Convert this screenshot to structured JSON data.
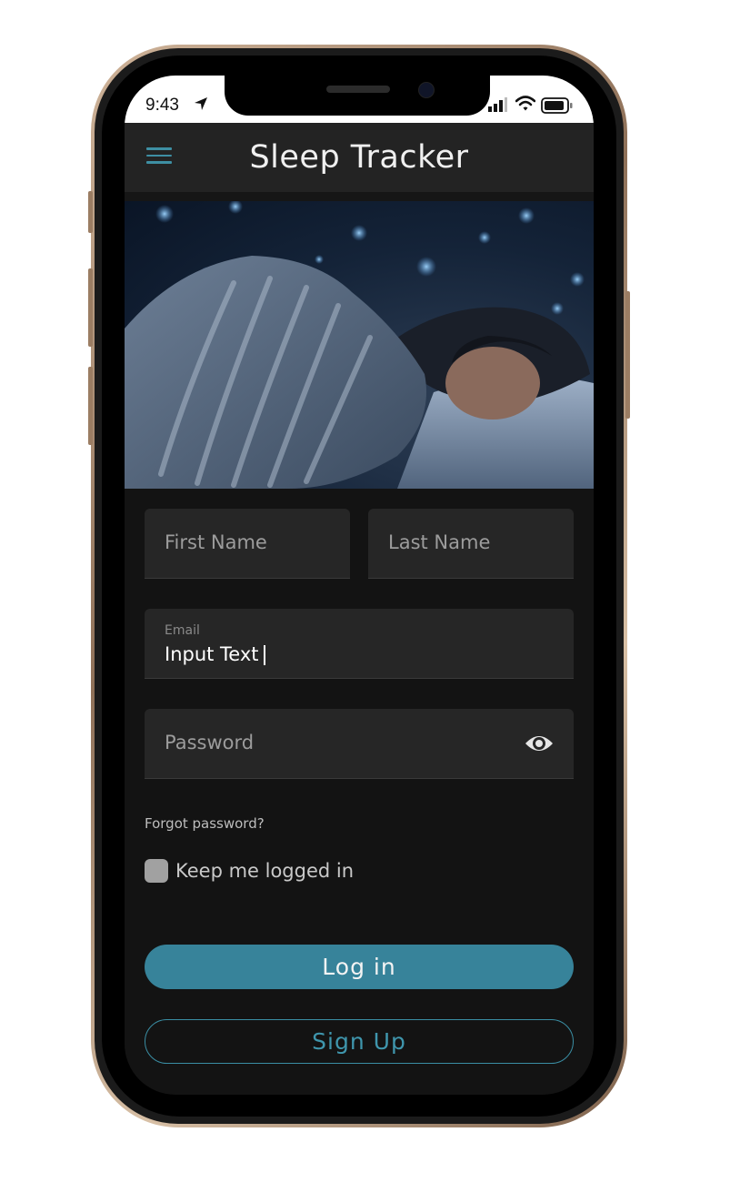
{
  "status_bar": {
    "time": "9:43"
  },
  "app_bar": {
    "title": "Sleep Tracker"
  },
  "form": {
    "first_name_placeholder": "First Name",
    "last_name_placeholder": "Last Name",
    "email_label": "Email",
    "email_value": "Input Text",
    "password_placeholder": "Password",
    "forgot_password": "Forgot password?",
    "keep_logged_in": "Keep me logged in",
    "keep_logged_in_checked": false
  },
  "buttons": {
    "login": "Log in",
    "signup": "Sign Up"
  },
  "colors": {
    "accent": "#37839a",
    "background": "#131313",
    "app_bar": "#232323",
    "field": "#262626"
  },
  "icons": [
    "location-arrow-icon",
    "signal-icon",
    "wifi-icon",
    "battery-icon",
    "menu-icon",
    "eye-icon"
  ]
}
